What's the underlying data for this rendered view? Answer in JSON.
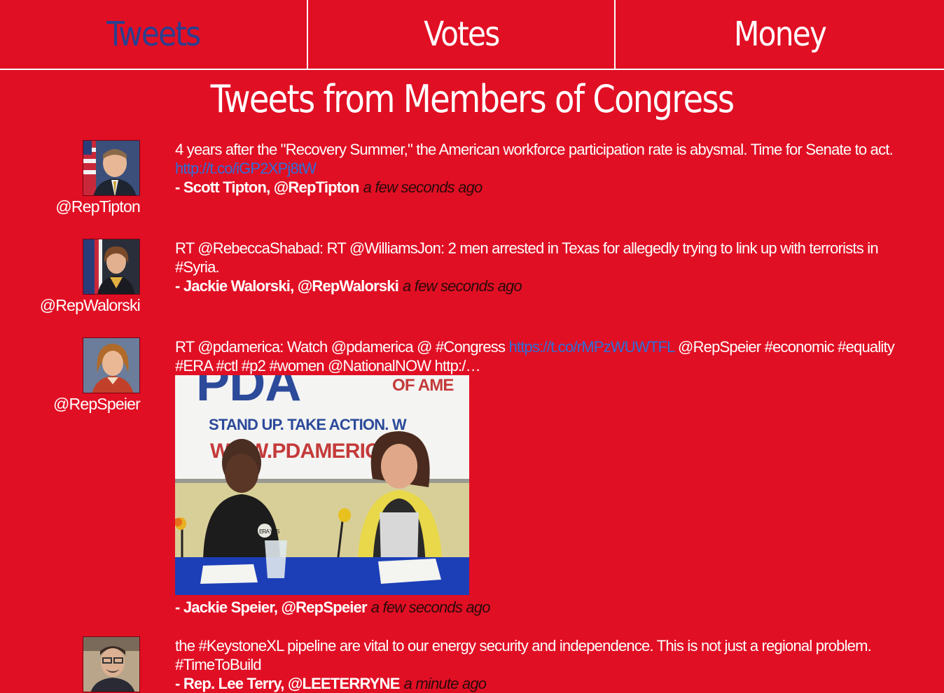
{
  "nav": {
    "tabs": [
      {
        "label": "Tweets",
        "active": true
      },
      {
        "label": "Votes",
        "active": false
      },
      {
        "label": "Money",
        "active": false
      }
    ]
  },
  "page": {
    "title": "Tweets from Members of Congress"
  },
  "tweets": [
    {
      "handle": "@RepTipton",
      "text": "4 years after the \"Recovery Summer,\" the American workforce participation rate is abysmal. Time for Senate to act.",
      "link": "http://t.co/iGP2XPj8tW",
      "author": "- Scott Tipton, @RepTipton",
      "time": "a few seconds ago"
    },
    {
      "handle": "@RepWalorski",
      "text": "RT @RebeccaShabad: RT @WilliamsJon: 2 men arrested in Texas for allegedly trying to link up with terrorists in #Syria.",
      "author": "- Jackie Walorski, @RepWalorski",
      "time": "a few seconds ago"
    },
    {
      "handle": "@RepSpeier",
      "text_before": "RT @pdamerica: Watch @pdamerica @ #Congress ",
      "link": "https://t.co/rMPzWUWTFL",
      "text_after": " @RepSpeier #economic #equality #ERA #ctl #p2 #women @NationalNOW http:/…",
      "media": {
        "banner_logo": "PDA",
        "banner_of": "OF AME",
        "banner_line1": "STAND UP. TAKE ACTION. W",
        "banner_line2": "WWW.PDAMERICA.C",
        "button_text": "ERA YES"
      },
      "author": "- Jackie Speier, @RepSpeier",
      "time": "a few seconds ago"
    },
    {
      "handle": "@LEETERRYNE",
      "text": "the #KeystoneXL pipeline are vital to our energy security and independence. This is not just a regional problem. #TimeToBuild",
      "author": "- Rep. Lee Terry, @LEETERRYNE",
      "time": "a minute ago"
    }
  ],
  "colors": {
    "background": "#e10f24",
    "active_tab": "#2b3f8f",
    "link": "#2f6fd6"
  }
}
